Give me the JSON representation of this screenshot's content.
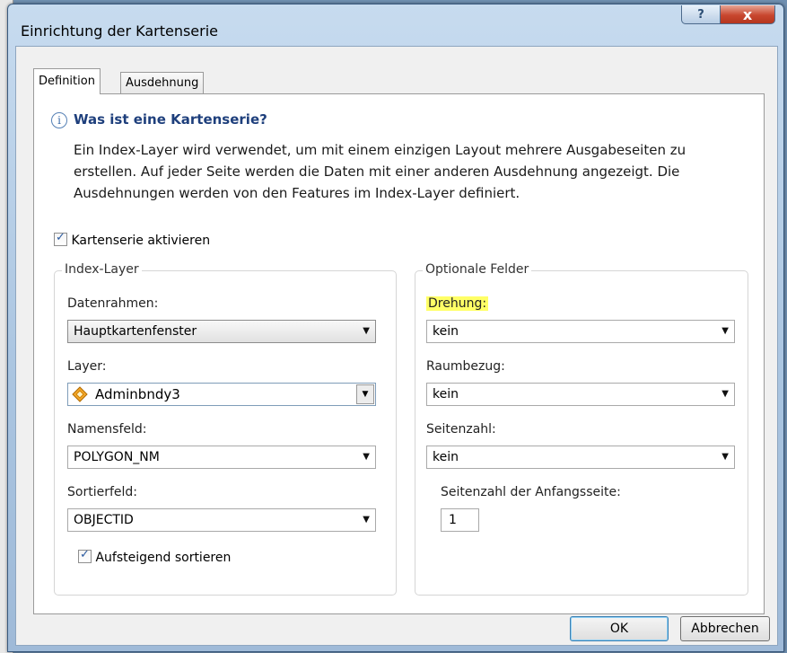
{
  "window": {
    "title": "Einrichtung der Kartenserie",
    "help_label": "?",
    "close_label": "x"
  },
  "tabs": [
    {
      "label": "Definition",
      "active": true
    },
    {
      "label": "Ausdehnung",
      "active": false
    }
  ],
  "info": {
    "icon_label": "i",
    "heading": "Was ist eine Kartenserie?",
    "lines": [
      "Ein Index-Layer wird verwendet, um mit einem einzigen Layout mehrere Ausgabeseiten zu",
      "erstellen. Auf jeder Seite werden die Daten mit einer anderen Ausdehnung angezeigt. Die",
      "Ausdehnungen werden von den Features im Index-Layer definiert."
    ]
  },
  "enable": {
    "label": "Kartenserie aktivieren",
    "checked": true
  },
  "index_layer": {
    "legend": "Index-Layer",
    "datenrahmen": {
      "label": "Datenrahmen:",
      "value": "Hauptkartenfenster"
    },
    "layer": {
      "label": "Layer:",
      "value": "Adminbndy3",
      "icon": "polygon-layer-icon"
    },
    "namensfeld": {
      "label": "Namensfeld:",
      "value": "POLYGON_NM"
    },
    "sortierfeld": {
      "label": "Sortierfeld:",
      "value": "OBJECTID"
    },
    "ascending": {
      "label": "Aufsteigend sortieren",
      "checked": true
    }
  },
  "optional_fields": {
    "legend": "Optionale Felder",
    "drehung": {
      "label": "Drehung:",
      "value": "kein",
      "highlight_color": "#ffff66"
    },
    "raumbezug": {
      "label": "Raumbezug:",
      "value": "kein"
    },
    "seitenzahl": {
      "label": "Seitenzahl:",
      "value": "kein"
    },
    "start_page": {
      "label": "Seitenzahl der Anfangsseite:",
      "value": "1"
    }
  },
  "buttons": {
    "ok": "OK",
    "cancel": "Abbrechen"
  }
}
